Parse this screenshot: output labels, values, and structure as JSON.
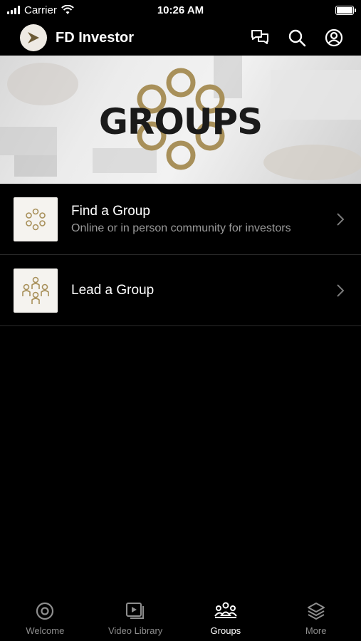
{
  "status": {
    "carrier": "Carrier",
    "time": "10:26 AM"
  },
  "header": {
    "title": "FD Investor"
  },
  "banner": {
    "title": "GROUPS"
  },
  "list": [
    {
      "title": "Find a Group",
      "subtitle": "Online or in person community for investors"
    },
    {
      "title": "Lead a Group",
      "subtitle": ""
    }
  ],
  "tabs": [
    {
      "label": "Welcome",
      "icon": "target-icon"
    },
    {
      "label": "Video Library",
      "icon": "video-library-icon"
    },
    {
      "label": "Groups",
      "icon": "groups-icon"
    },
    {
      "label": "More",
      "icon": "layers-icon"
    }
  ],
  "active_tab": "Groups",
  "colors": {
    "gold": "#a8905a",
    "background": "#000000",
    "inactive": "#8e8e8e"
  }
}
